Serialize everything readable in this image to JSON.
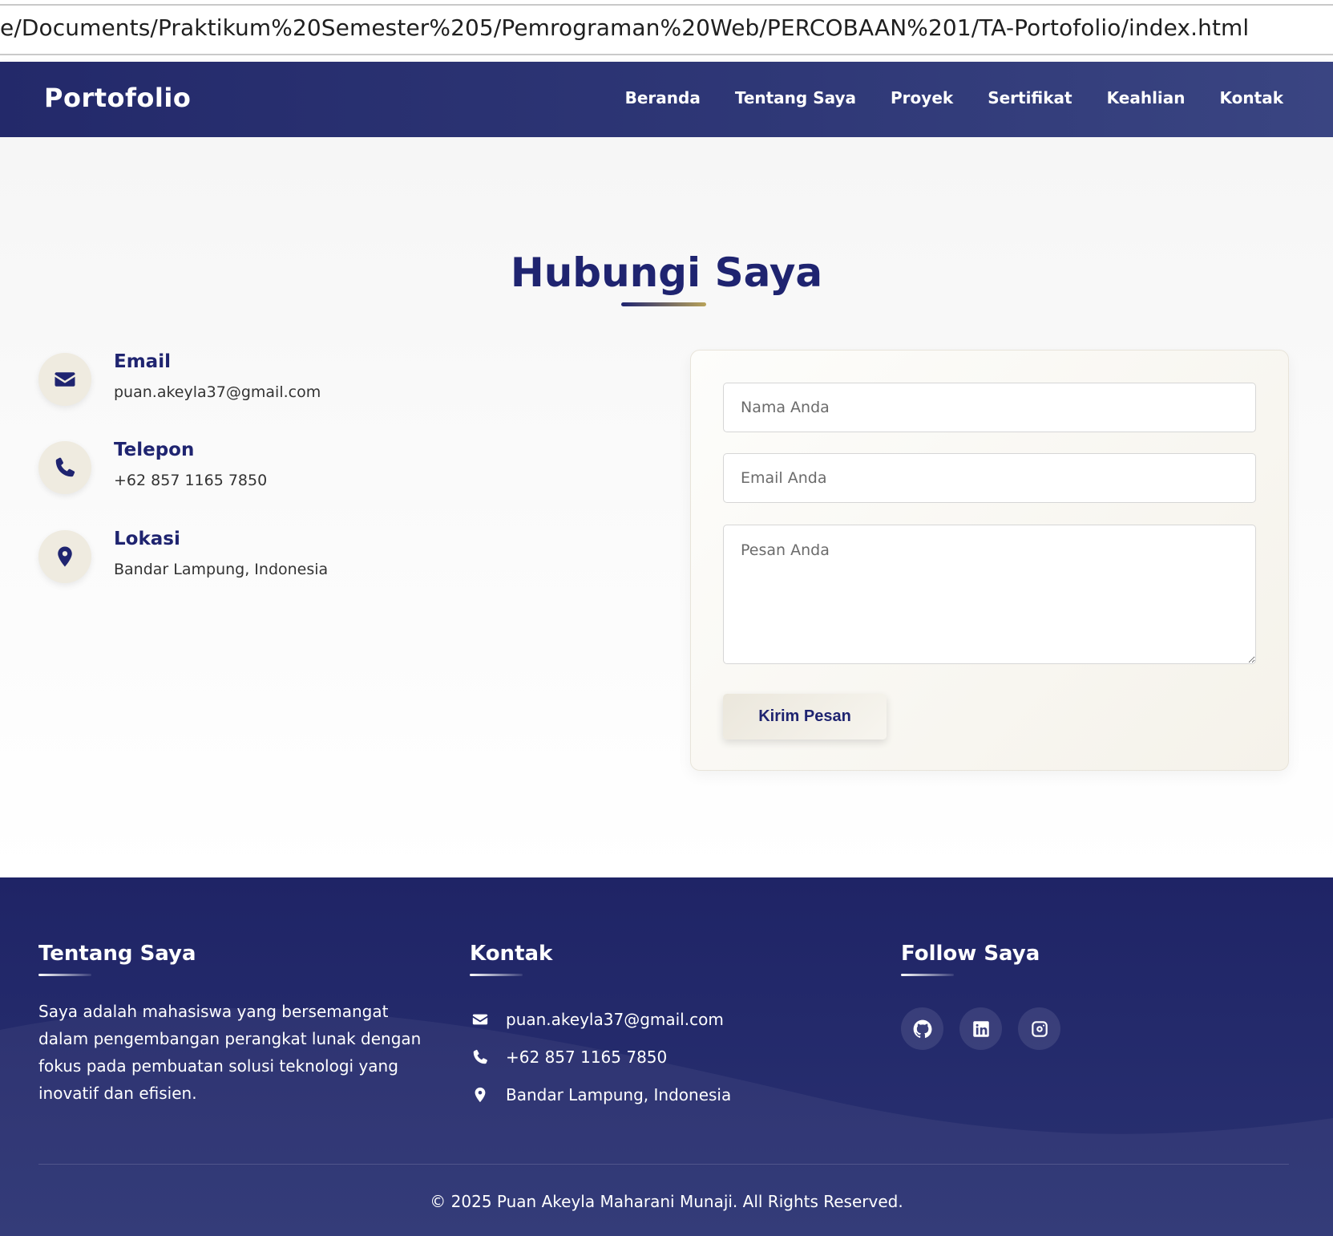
{
  "browser": {
    "url": "e/Documents/Praktikum%20Semester%205/Pemrograman%20Web/PERCOBAAN%201/TA-Portofolio/index.html"
  },
  "navbar": {
    "brand": "Portofolio",
    "links": [
      "Beranda",
      "Tentang Saya",
      "Proyek",
      "Sertifikat",
      "Keahlian",
      "Kontak"
    ]
  },
  "contact": {
    "title": "Hubungi Saya",
    "info": [
      {
        "label": "Email",
        "value": "puan.akeyla37@gmail.com",
        "icon": "envelope-icon"
      },
      {
        "label": "Telepon",
        "value": "+62 857 1165 7850",
        "icon": "phone-icon"
      },
      {
        "label": "Lokasi",
        "value": "Bandar Lampung, Indonesia",
        "icon": "map-marker-icon"
      }
    ],
    "form": {
      "name_placeholder": "Nama Anda",
      "email_placeholder": "Email Anda",
      "message_placeholder": "Pesan Anda",
      "submit_label": "Kirim Pesan"
    }
  },
  "footer": {
    "about": {
      "heading": "Tentang Saya",
      "text": "Saya adalah mahasiswa yang bersemangat dalam pengembangan perangkat lunak dengan fokus pada pembuatan solusi teknologi yang inovatif dan efisien."
    },
    "contact": {
      "heading": "Kontak",
      "email": "puan.akeyla37@gmail.com",
      "phone": "+62 857 1165 7850",
      "location": "Bandar Lampung, Indonesia"
    },
    "social": {
      "heading": "Follow Saya",
      "icons": [
        "github-icon",
        "linkedin-icon",
        "instagram-icon"
      ]
    },
    "copyright": "© 2025 Puan Akeyla Maharani Munaji. All Rights Reserved."
  },
  "colors": {
    "primary": "#1f2470",
    "accent_gold": "#b9a35a",
    "icon_bg": "#efebe0",
    "footer_bg": "#1f2466"
  }
}
